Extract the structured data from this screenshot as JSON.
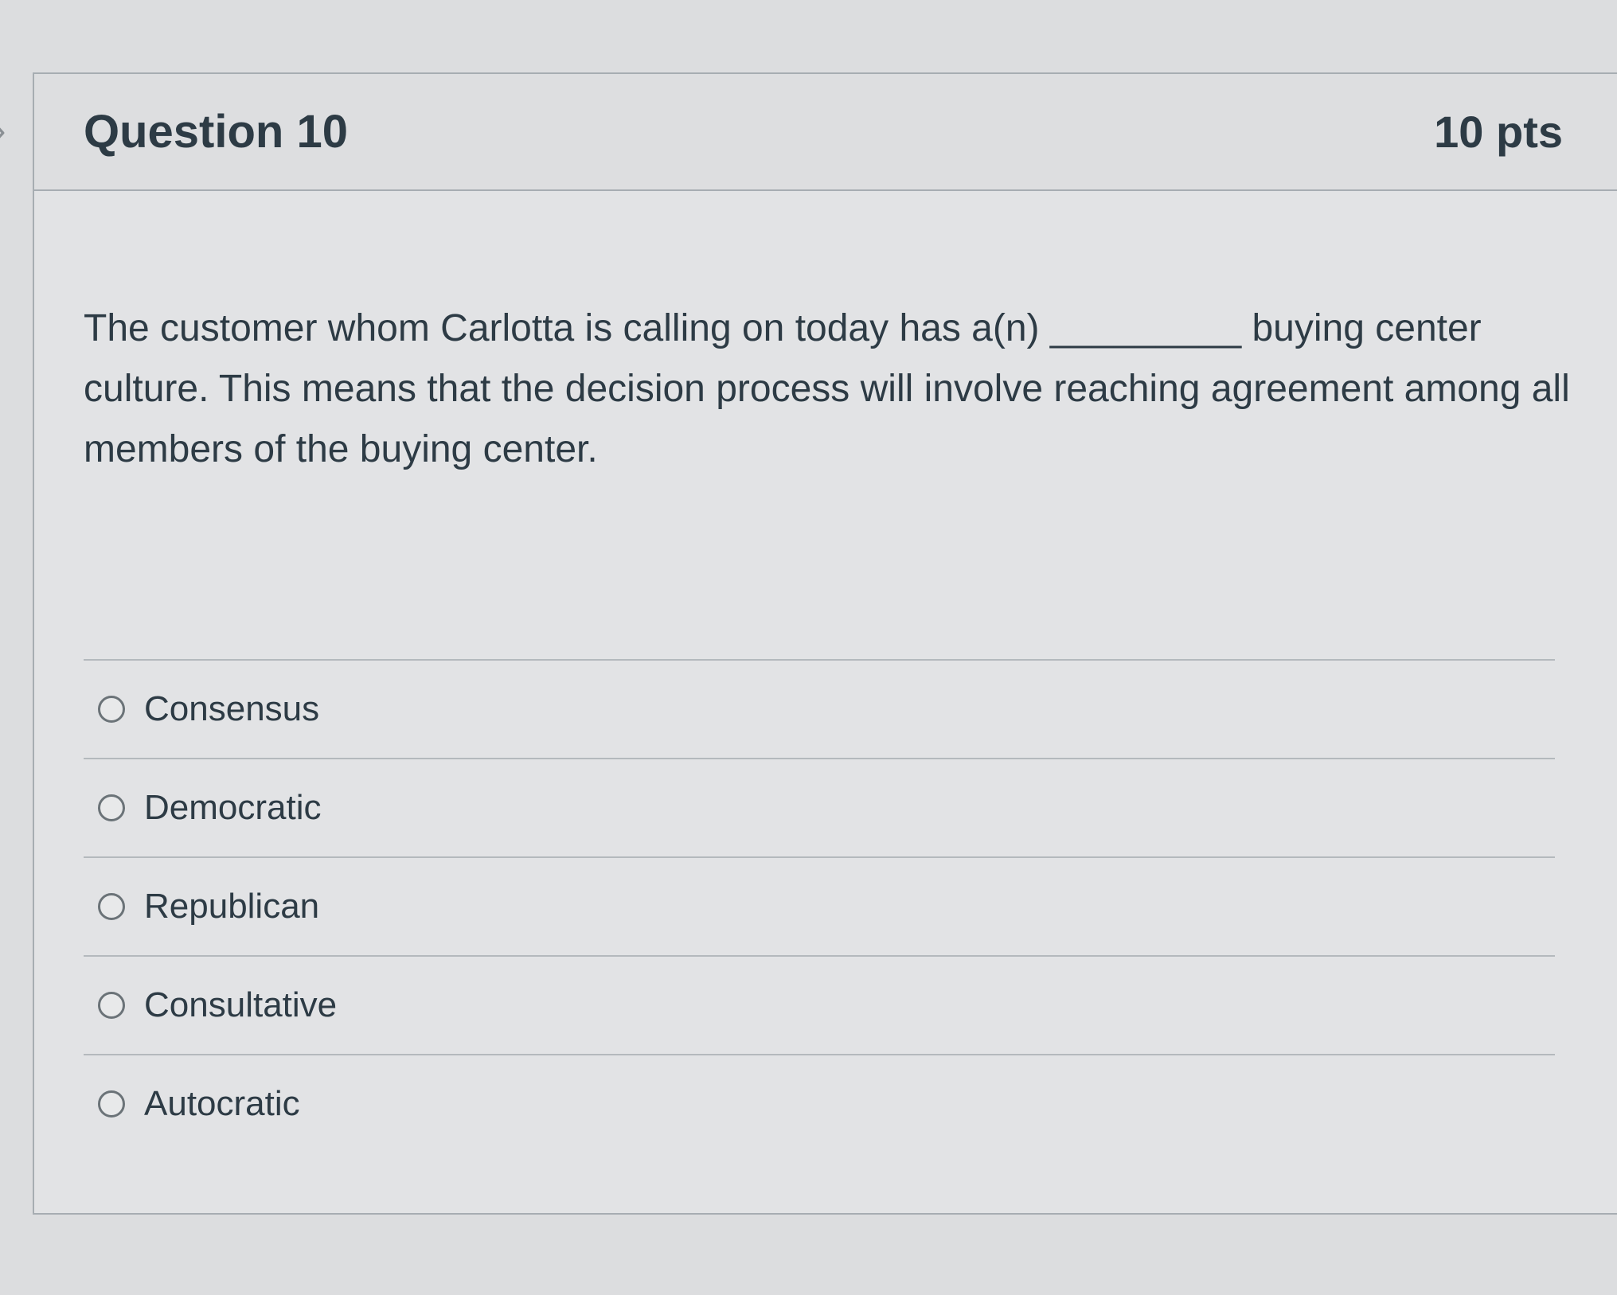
{
  "question": {
    "title": "Question 10",
    "points": "10 pts",
    "prompt": "The customer whom Carlotta is calling on today has a(n) _________ buying center culture. This means that the decision process will involve reaching agreement among all members of the buying center."
  },
  "answers": [
    {
      "label": "Consensus"
    },
    {
      "label": "Democratic"
    },
    {
      "label": "Republican"
    },
    {
      "label": "Consultative"
    },
    {
      "label": "Autocratic"
    }
  ],
  "icons": {
    "nav": "chevron-right-icon",
    "radio": "radio-unselected-icon"
  }
}
